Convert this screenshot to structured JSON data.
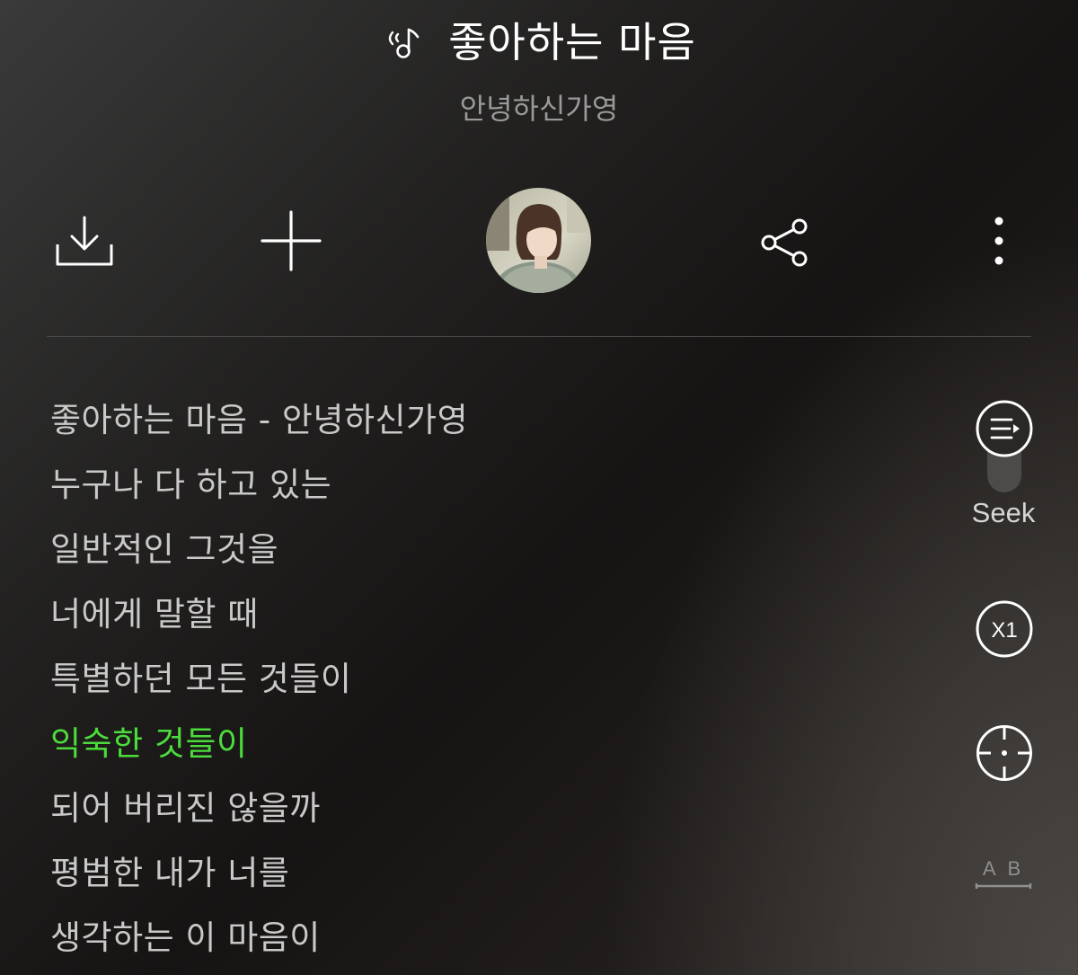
{
  "header": {
    "title": "좋아하는 마음",
    "artist": "안녕하신가영",
    "title_icon": "music-note-sound-icon"
  },
  "actions": [
    {
      "name": "download",
      "icon": "download-icon"
    },
    {
      "name": "add",
      "icon": "plus-icon"
    },
    {
      "name": "artist-avatar",
      "icon": "avatar"
    },
    {
      "name": "share",
      "icon": "share-icon"
    },
    {
      "name": "more",
      "icon": "more-vertical-icon"
    }
  ],
  "lyrics": {
    "lines": [
      "좋아하는 마음 - 안녕하신가영",
      "누구나 다 하고 있는",
      "일반적인 그것을",
      "너에게 말할 때",
      "특별하던 모든 것들이",
      "익숙한 것들이",
      "되어 버리진 않을까",
      "평범한 내가 너를",
      "생각하는 이 마음이"
    ],
    "active_index": 5
  },
  "side_controls": {
    "seek_label": "Seek",
    "speed_label": "X1",
    "ab_label": "A B"
  },
  "colors": {
    "active_lyric": "#4bdc3c",
    "lyric": "#c9c9c9",
    "artist": "#9a9a9a"
  }
}
